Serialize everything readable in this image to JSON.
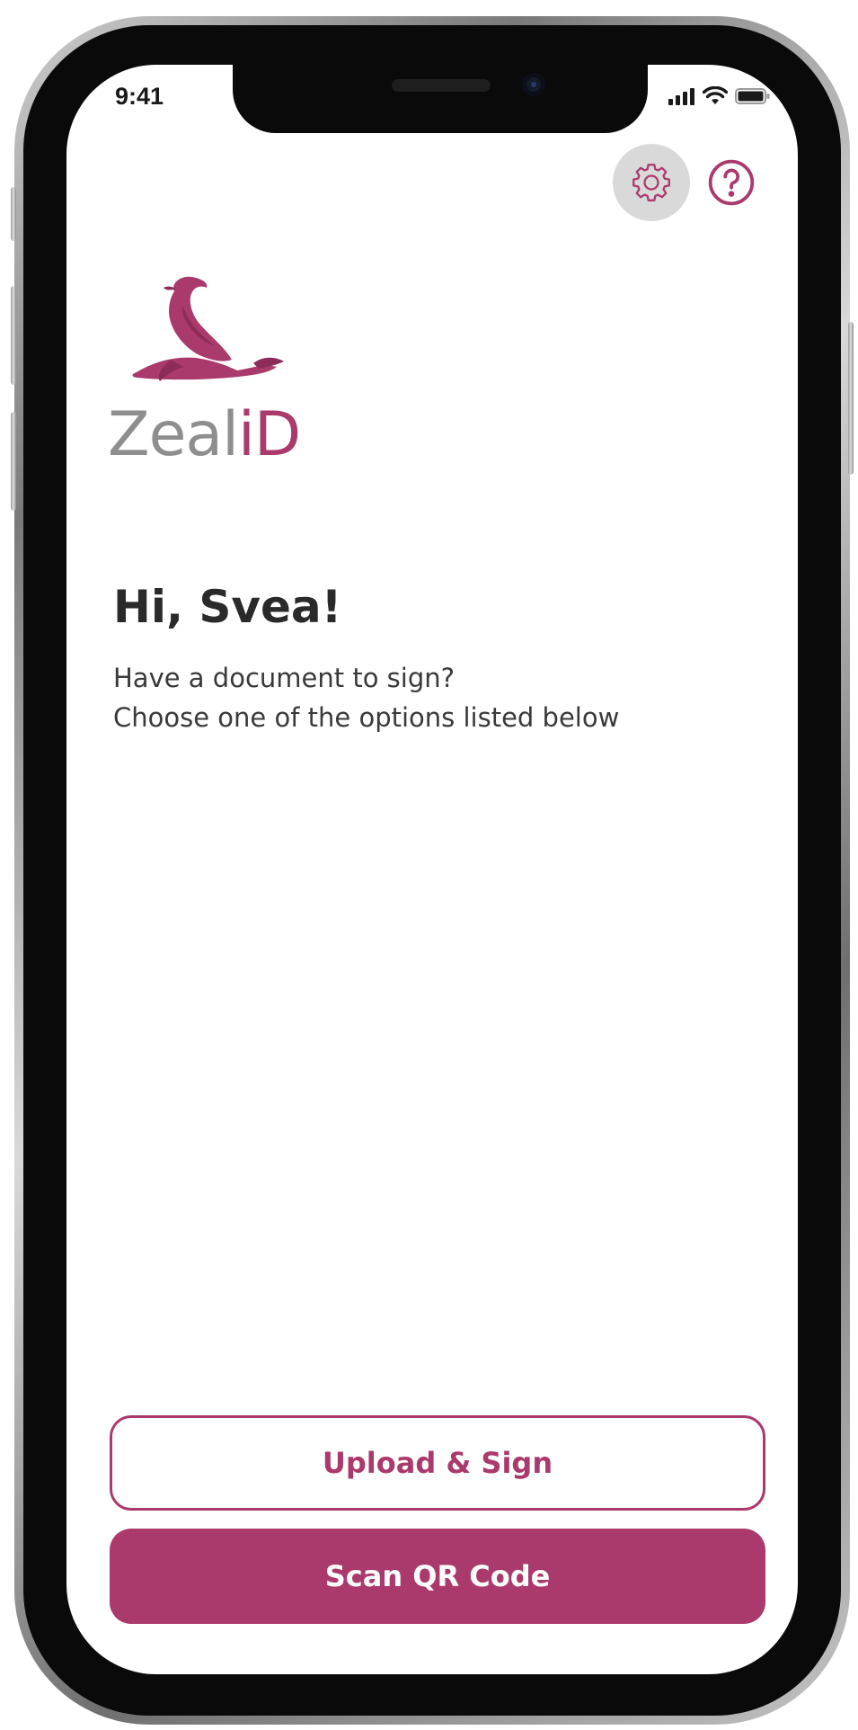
{
  "status_bar": {
    "time": "9:41"
  },
  "top_actions": {
    "settings_icon": "gear-icon",
    "help_icon": "question-circle-icon"
  },
  "brand": {
    "name_part1": "Zeal",
    "name_part2": "iD",
    "logo_icon": "sea-lion-logo",
    "accent_color": "#ab3a6c",
    "grey_color": "#8e8e8e"
  },
  "main": {
    "greeting": "Hi, Svea!",
    "subtitle_line1": "Have a document to sign?",
    "subtitle_line2": "Choose one of the options listed below"
  },
  "actions": {
    "upload_label": "Upload & Sign",
    "scan_label": "Scan QR Code"
  }
}
